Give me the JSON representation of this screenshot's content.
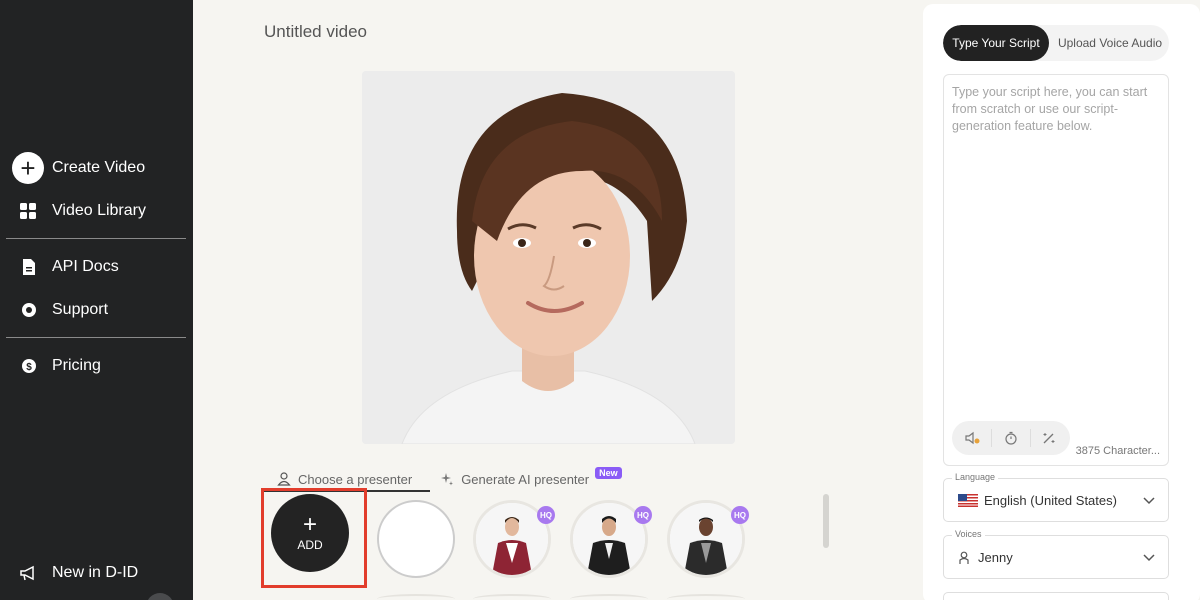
{
  "sidebar": {
    "items": [
      {
        "label": "Create Video",
        "icon": "plus-circle-icon"
      },
      {
        "label": "Video Library",
        "icon": "grid-icon"
      },
      {
        "label": "API Docs",
        "icon": "document-icon"
      },
      {
        "label": "Support",
        "icon": "lifebuoy-icon"
      },
      {
        "label": "Pricing",
        "icon": "dollar-icon"
      },
      {
        "label": "New in D-ID",
        "icon": "megaphone-icon"
      }
    ]
  },
  "main": {
    "title": "Untitled video",
    "tabs": [
      {
        "label": "Choose a presenter",
        "icon": "person-icon"
      },
      {
        "label": "Generate AI presenter",
        "icon": "sparkle-icon",
        "badge": "New"
      }
    ],
    "add_label": "ADD",
    "add_symbol": "+",
    "hq_badge": "HQ"
  },
  "script_panel": {
    "tabs": {
      "active": "Type Your Script",
      "inactive": "Upload Voice Audio"
    },
    "placeholder": "Type your script here, you can start from scratch or use our script-generation feature below.",
    "char_count": "3875 Character...",
    "language": {
      "label": "Language",
      "value": "English (United States)"
    },
    "voices": {
      "label": "Voices",
      "value": "Jenny"
    }
  },
  "colors": {
    "sidebar_bg": "#222324",
    "accent_purple": "#a879ef",
    "highlight_red": "#e23d2c",
    "active_tab_bg": "#222222"
  }
}
